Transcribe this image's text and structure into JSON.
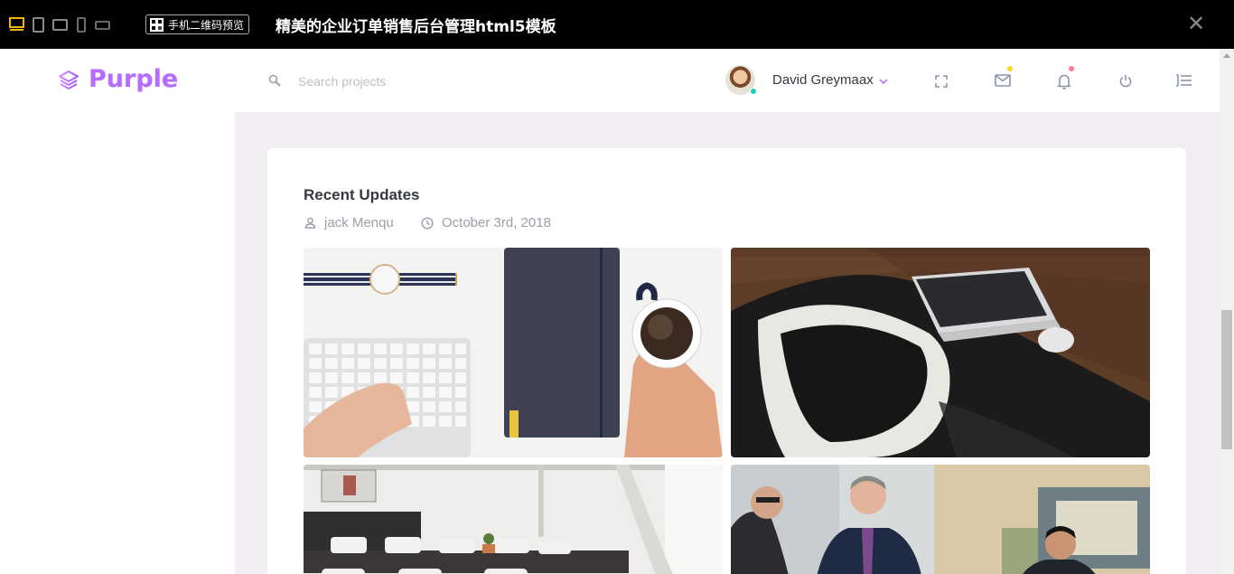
{
  "preview_bar": {
    "qr_button_label": "手机二维码预览",
    "title": "精美的企业订单销售后台管理html5模板",
    "close_glyph": "✕",
    "device_icons": [
      "desktop-icon",
      "tablet-portrait-icon",
      "tablet-landscape-icon",
      "phone-portrait-icon",
      "phone-landscape-icon"
    ]
  },
  "navbar": {
    "brand": "Purple",
    "search": {
      "placeholder": "Search projects",
      "value": ""
    },
    "user_name": "David Greymaax",
    "icons": [
      "fullscreen-icon",
      "mail-icon",
      "bell-icon",
      "power-icon",
      "format-list-icon"
    ]
  },
  "card": {
    "title": "Recent Updates",
    "author": "jack Menqu",
    "date": "October 3rd, 2018",
    "photos": [
      "workspace-keyboard-coffee-photo",
      "laptop-desk-chair-photo",
      "meeting-room-photo",
      "business-meeting-photo"
    ]
  },
  "colors": {
    "brand_gradient_start": "#da8cff",
    "brand_gradient_end": "#9a55ff",
    "content_bg": "#f2edf3",
    "mail_badge": "#fed713",
    "bell_badge": "#fe7c96",
    "online_dot": "#1bcfb4",
    "active_device": "#f5b400"
  }
}
